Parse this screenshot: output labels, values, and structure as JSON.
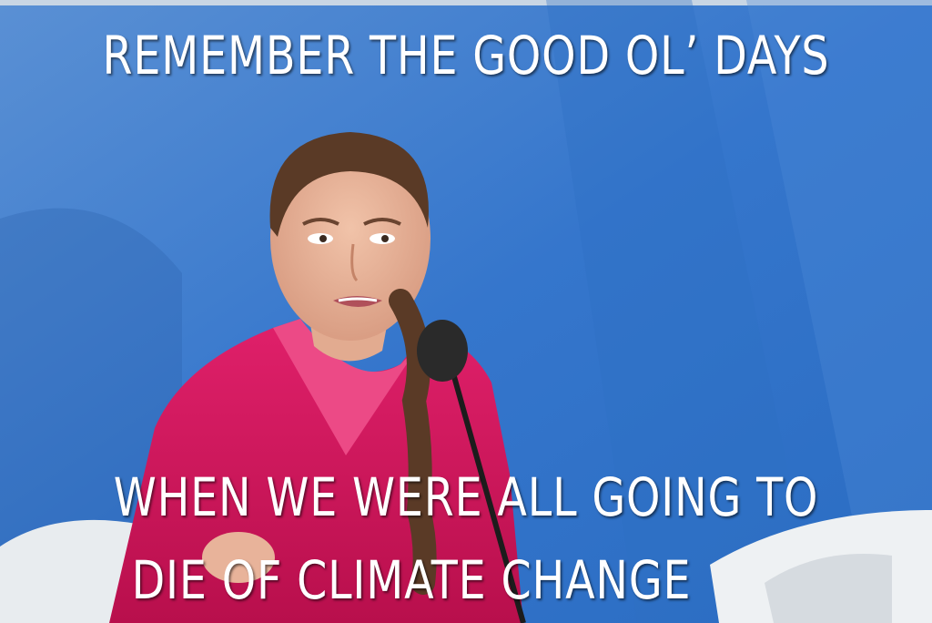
{
  "meme": {
    "top_text": "REMEMBER THE GOOD OL’ DAYS",
    "bottom_text_line1": "WHEN WE WERE ALL GOING TO",
    "bottom_text_line2": "DIE OF CLIMATE CHANGE"
  },
  "colors": {
    "background": "#3c7fd0",
    "shirt": "#d4145a",
    "text": "#ffffff"
  }
}
